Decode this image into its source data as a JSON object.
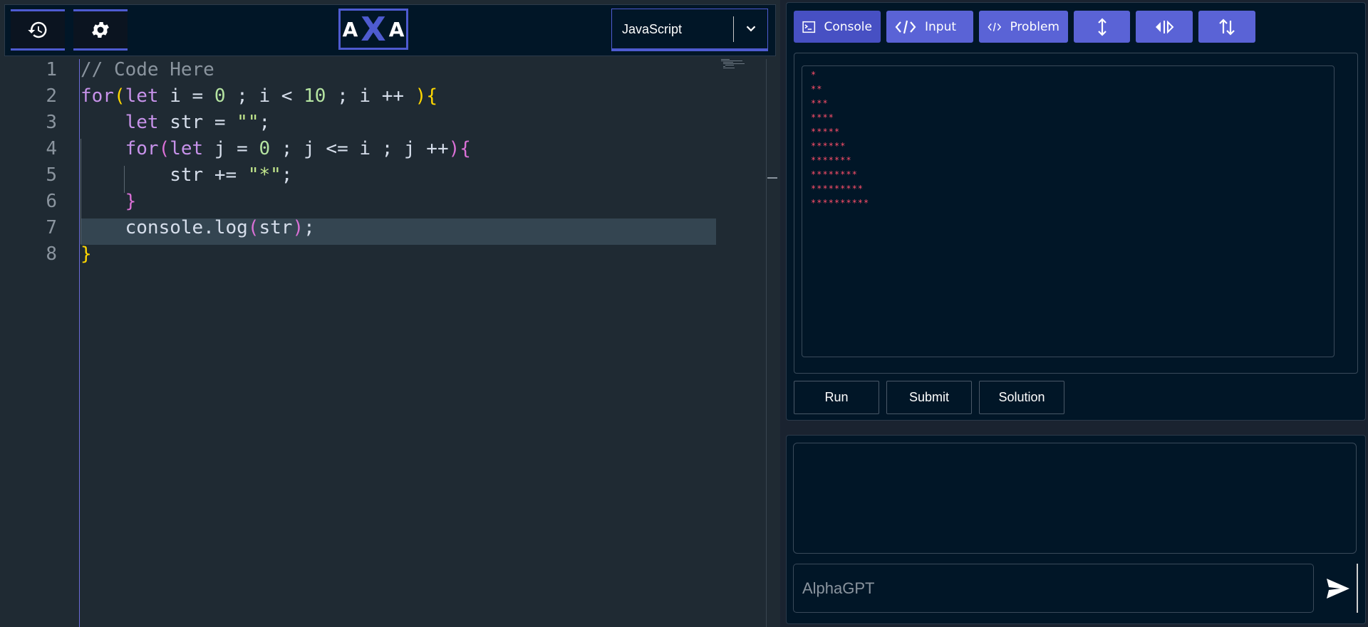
{
  "toolbar": {
    "history_icon": "history-icon",
    "settings_icon": "gear-icon",
    "logo": {
      "left": "A",
      "mid": "X",
      "right": "A"
    },
    "language": {
      "selected": "JavaScript",
      "icon": "chevron-down-icon"
    }
  },
  "editor": {
    "line_numbers": [
      "1",
      "2",
      "3",
      "4",
      "5",
      "6",
      "7",
      "8"
    ],
    "lines": [
      "// Code Here",
      "for(let i = 0 ; i < 10 ; i ++ ){",
      "    let str = \"\";",
      "    for(let j = 0 ; j <= i ; j ++){",
      "        str += \"*\";",
      "    }",
      "    console.log(str);",
      "}"
    ],
    "current_line": 7
  },
  "tabs": [
    {
      "label": "Console",
      "icon": "terminal-icon"
    },
    {
      "label": "Input",
      "icon": "code-icon"
    },
    {
      "label": "Problem",
      "icon": "code-icon"
    },
    {
      "label": "",
      "icon": "vertical-resize-icon"
    },
    {
      "label": "",
      "icon": "horizontal-split-icon"
    },
    {
      "label": "",
      "icon": "swap-vertical-icon"
    }
  ],
  "console": {
    "output": [
      "*",
      "**",
      "***",
      "****",
      "*****",
      "******",
      "*******",
      "********",
      "*********",
      "**********"
    ]
  },
  "actions": {
    "run": "Run",
    "submit": "Submit",
    "solution": "Solution"
  },
  "chat": {
    "placeholder": "AlphaGPT",
    "send_icon": "send-icon"
  },
  "colors": {
    "accent": "#5a63d6",
    "panel": "#011627",
    "output": "#ff4f6a"
  }
}
